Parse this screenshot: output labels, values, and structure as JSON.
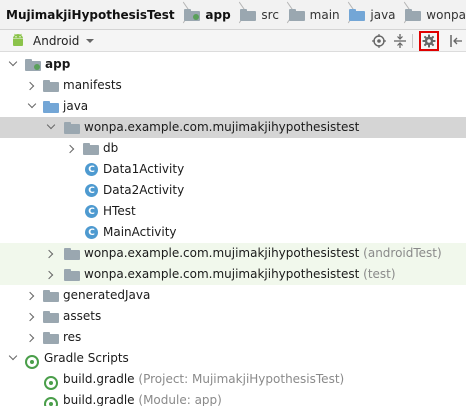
{
  "breadcrumb": {
    "project": "MujimakjiHypothesisTest",
    "items": [
      "app",
      "src",
      "main",
      "java",
      "wonpa"
    ]
  },
  "toolbar": {
    "view_mode": "Android",
    "icons": [
      "target-icon",
      "collapse-all-icon",
      "settings-icon",
      "hide-icon"
    ],
    "highlight_color": "#e00000"
  },
  "tree": {
    "app": "app",
    "manifests": "manifests",
    "java": "java",
    "package_main": "wonpa.example.com.mujimakjihypothesistest",
    "db": "db",
    "classes": [
      "Data1Activity",
      "Data2Activity",
      "HTest",
      "MainActivity"
    ],
    "package_android_test": "wonpa.example.com.mujimakjihypothesistest",
    "package_android_test_suffix": "(androidTest)",
    "package_test": "wonpa.example.com.mujimakjihypothesistest",
    "package_test_suffix": "(test)",
    "generated_java": "generatedJava",
    "assets": "assets",
    "res": "res",
    "gradle_scripts": "Gradle Scripts",
    "build_gradle_project": "build.gradle",
    "build_gradle_project_suffix": "(Project: MujimakjiHypothesisTest)",
    "build_gradle_module": "build.gradle",
    "build_gradle_module_suffix": "(Module: app)"
  }
}
